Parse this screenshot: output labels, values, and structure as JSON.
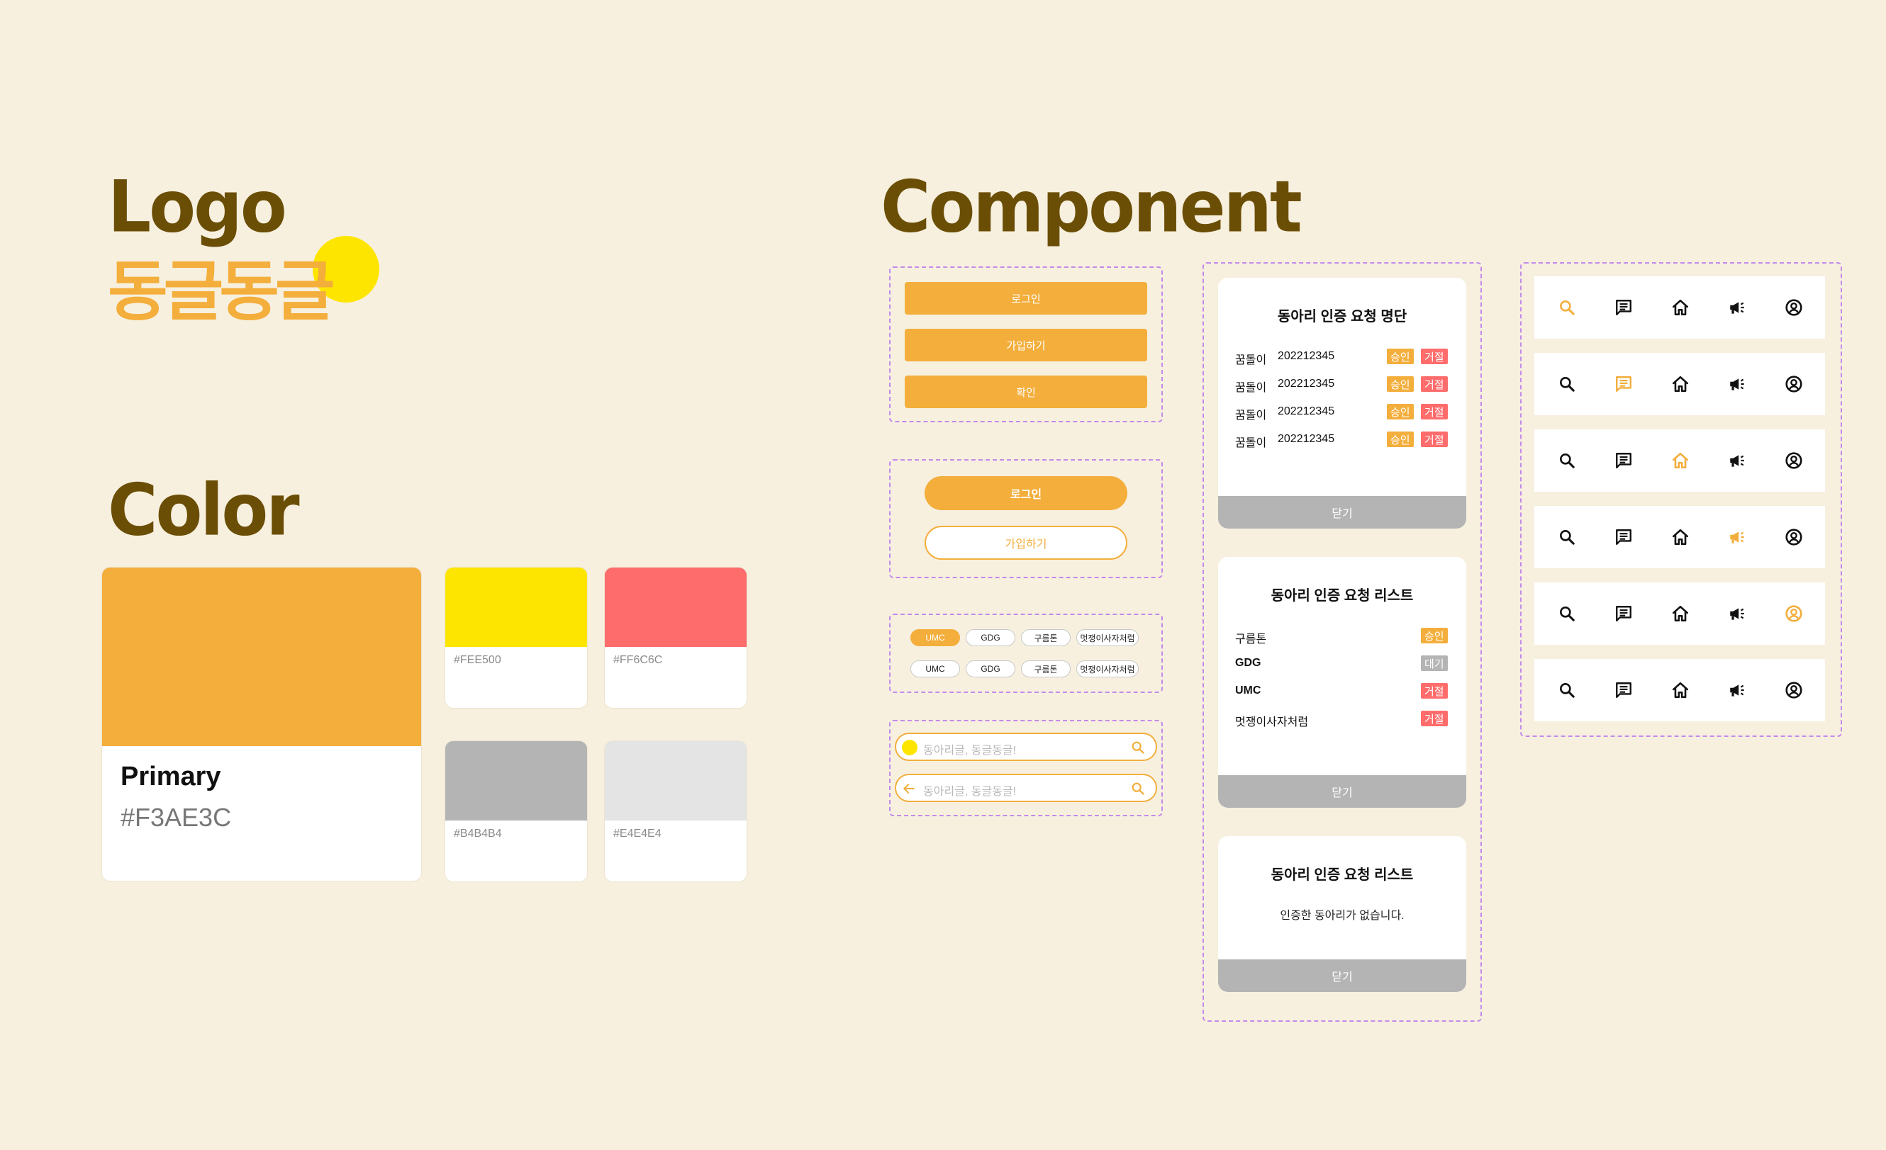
{
  "headings": {
    "logo": "Logo",
    "color": "Color",
    "component": "Component"
  },
  "logo": {
    "wordmark": "동글동글",
    "sun_color": "#FEE500",
    "text_color": "#F3AE3C"
  },
  "colors": {
    "primary": {
      "name": "Primary",
      "hex": "#F3AE3C"
    },
    "swatches": [
      {
        "hex": "#FEE500"
      },
      {
        "hex": "#FF6C6C"
      },
      {
        "hex": "#B4B4B4"
      },
      {
        "hex": "#E4E4E4"
      }
    ]
  },
  "buttons": {
    "rect": [
      "로그인",
      "가입하기",
      "확인"
    ],
    "pill_filled": "로그인",
    "pill_outline": "가입하기"
  },
  "chips": {
    "row1": [
      "UMC",
      "GDG",
      "구름톤",
      "멋쟁이사자처럼"
    ],
    "row2": [
      "UMC",
      "GDG",
      "구름톤",
      "멋쟁이사자처럼"
    ],
    "active": "UMC"
  },
  "search": {
    "placeholder1": "동아리글, 동글동글!",
    "placeholder2": "동아리글, 동글동글!"
  },
  "modal1": {
    "title": "동아리 인증 요청 명단",
    "rows": [
      {
        "name": "꿈돌이",
        "id": "202212345",
        "approve": "승인",
        "reject": "거절"
      },
      {
        "name": "꿈돌이",
        "id": "202212345",
        "approve": "승인",
        "reject": "거절"
      },
      {
        "name": "꿈돌이",
        "id": "202212345",
        "approve": "승인",
        "reject": "거절"
      },
      {
        "name": "꿈돌이",
        "id": "202212345",
        "approve": "승인",
        "reject": "거절"
      }
    ],
    "close": "닫기"
  },
  "modal2": {
    "title": "동아리 인증 요청 리스트",
    "rows": [
      {
        "name": "구름톤",
        "status": "승인",
        "kind": "ok"
      },
      {
        "name": "GDG",
        "status": "대기",
        "kind": "wait"
      },
      {
        "name": "UMC",
        "status": "거절",
        "kind": "no"
      },
      {
        "name": "멋쟁이사자처럼",
        "status": "거절",
        "kind": "no"
      }
    ],
    "close": "닫기"
  },
  "modal3": {
    "title": "동아리 인증 요청 리스트",
    "empty": "인증한 동아리가 없습니다.",
    "close": "닫기"
  },
  "navbars": {
    "icons": [
      "search-icon",
      "message-icon",
      "home-icon",
      "megaphone-icon",
      "profile-icon"
    ],
    "active_index_per_bar": [
      0,
      1,
      2,
      3,
      4,
      -1
    ],
    "active_color": "#F3AE3C",
    "inactive_color": "#111111"
  }
}
